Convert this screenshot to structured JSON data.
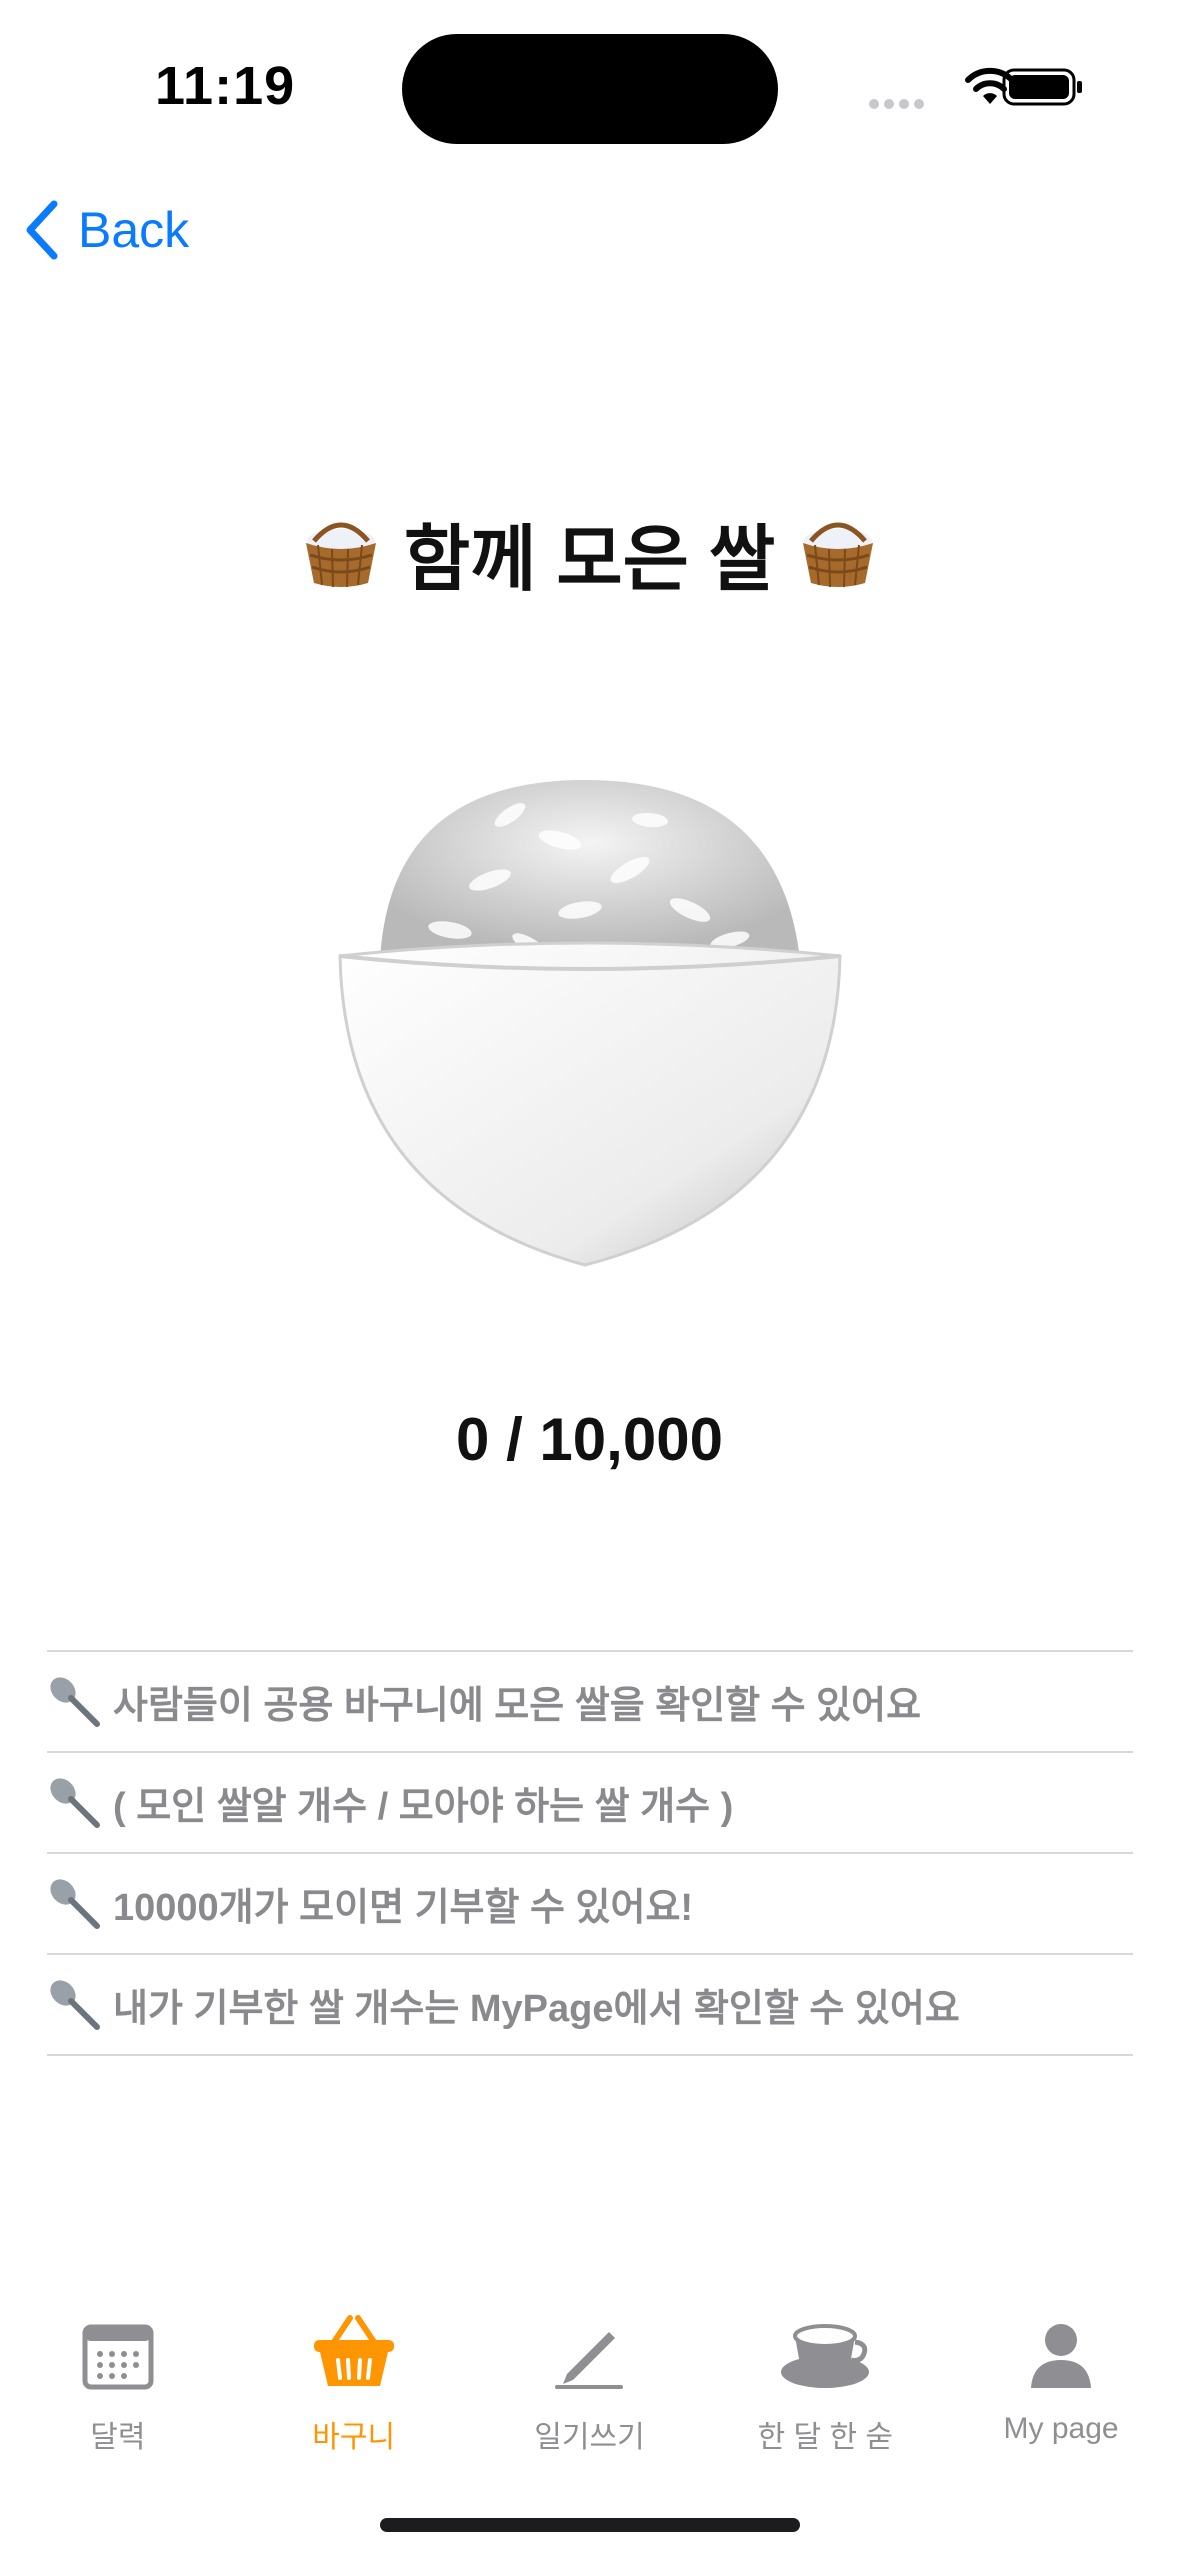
{
  "status": {
    "time": "11:19"
  },
  "nav": {
    "back_label": "Back"
  },
  "title": "함께 모은 쌀",
  "counter": "0 / 10,000",
  "info_items": [
    "사람들이 공용 바구니에 모은 쌀을 확인할 수 있어요",
    "( 모인 쌀알 개수 / 모아야 하는 쌀 개수 )",
    "10000개가 모이면 기부할 수 있어요!",
    "내가 기부한 쌀 개수는 MyPage에서 확인할 수 있어요"
  ],
  "tabs": [
    {
      "label": "달력",
      "icon": "calendar-icon",
      "active": false
    },
    {
      "label": "바구니",
      "icon": "basket-icon",
      "active": true
    },
    {
      "label": "일기쓰기",
      "icon": "pencil-icon",
      "active": false
    },
    {
      "label": "한 달 한 숟",
      "icon": "coffee-cup-icon",
      "active": false
    },
    {
      "label": "My page",
      "icon": "person-icon",
      "active": false
    }
  ],
  "colors": {
    "accent": "#0a7aff",
    "active_tab": "#ff9500",
    "inactive_tab": "#8e8e93"
  }
}
